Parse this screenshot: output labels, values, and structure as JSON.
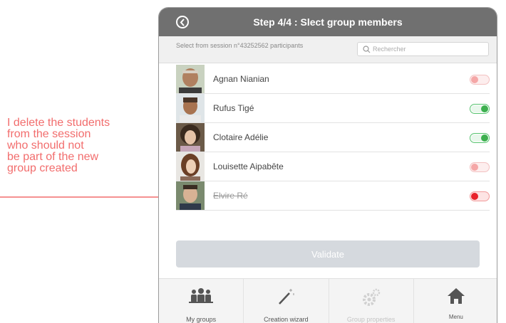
{
  "annotation": {
    "text": "I delete the students\nfrom the session\nwho should not\nbe part of the new\ngroup created",
    "color": "#f26d6d"
  },
  "header": {
    "title": "Step 4/4 : Slect group members",
    "back_icon": "chevron-left-circle-icon"
  },
  "subheader": {
    "session_text": "Select from session n°43252562 participants",
    "search": {
      "placeholder": "Rechercher",
      "value": ""
    }
  },
  "participants": [
    {
      "name": "Agnan Nianian",
      "selected": false,
      "deleted": false
    },
    {
      "name": "Rufus Tigé",
      "selected": true,
      "deleted": false
    },
    {
      "name": "Clotaire Adélie",
      "selected": true,
      "deleted": false
    },
    {
      "name": "Louisette Aipabête",
      "selected": false,
      "deleted": false
    },
    {
      "name": "Elvire Ré",
      "selected": false,
      "deleted": true
    }
  ],
  "validate_label": "Validate",
  "tabbar": {
    "tabs": [
      {
        "label": "My groups",
        "icon": "group-icon",
        "enabled": true
      },
      {
        "label": "Creation wizard",
        "icon": "magic-wand-icon",
        "enabled": true
      },
      {
        "label": "Group properties",
        "icon": "gears-icon",
        "enabled": false
      },
      {
        "label": "Menu",
        "icon": "home-icon",
        "enabled": true
      }
    ]
  },
  "colors": {
    "header_bg": "#707070",
    "toggle_on": "#3db04f",
    "toggle_off": "#f5a7a7",
    "toggle_delete": "#e8232b",
    "validate_bg": "#d5d9de",
    "icon_dark": "#555555"
  }
}
